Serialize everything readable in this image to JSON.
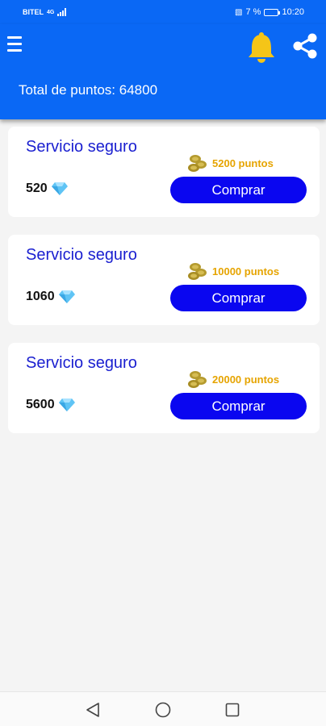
{
  "status_bar": {
    "carrier": "BITEL",
    "network": "4G",
    "battery": "7 %",
    "time": "10:20"
  },
  "app_bar": {
    "menu_icon": "hamburger-menu-icon",
    "bell_icon": "bell-icon",
    "share_icon": "share-icon",
    "bell_color": "#f5c518",
    "background_color": "#0a68f5"
  },
  "total": {
    "text": "Total de puntos: 64800"
  },
  "products": [
    {
      "title": "Servicio seguro",
      "price": "5200 puntos",
      "gems": "520",
      "button": "Comprar"
    },
    {
      "title": "Servicio seguro",
      "price": "10000 puntos",
      "gems": "1060",
      "button": "Comprar"
    },
    {
      "title": "Servicio seguro",
      "price": "20000 puntos",
      "gems": "5600",
      "button": "Comprar"
    }
  ],
  "colors": {
    "title_blue": "#1a1fd0",
    "price_gold": "#e6a400",
    "button_blue": "#0a06f0"
  },
  "nav_bar": {
    "back_icon": "back-triangle-icon",
    "home_icon": "home-circle-icon",
    "recent_icon": "recent-apps-square-icon"
  }
}
